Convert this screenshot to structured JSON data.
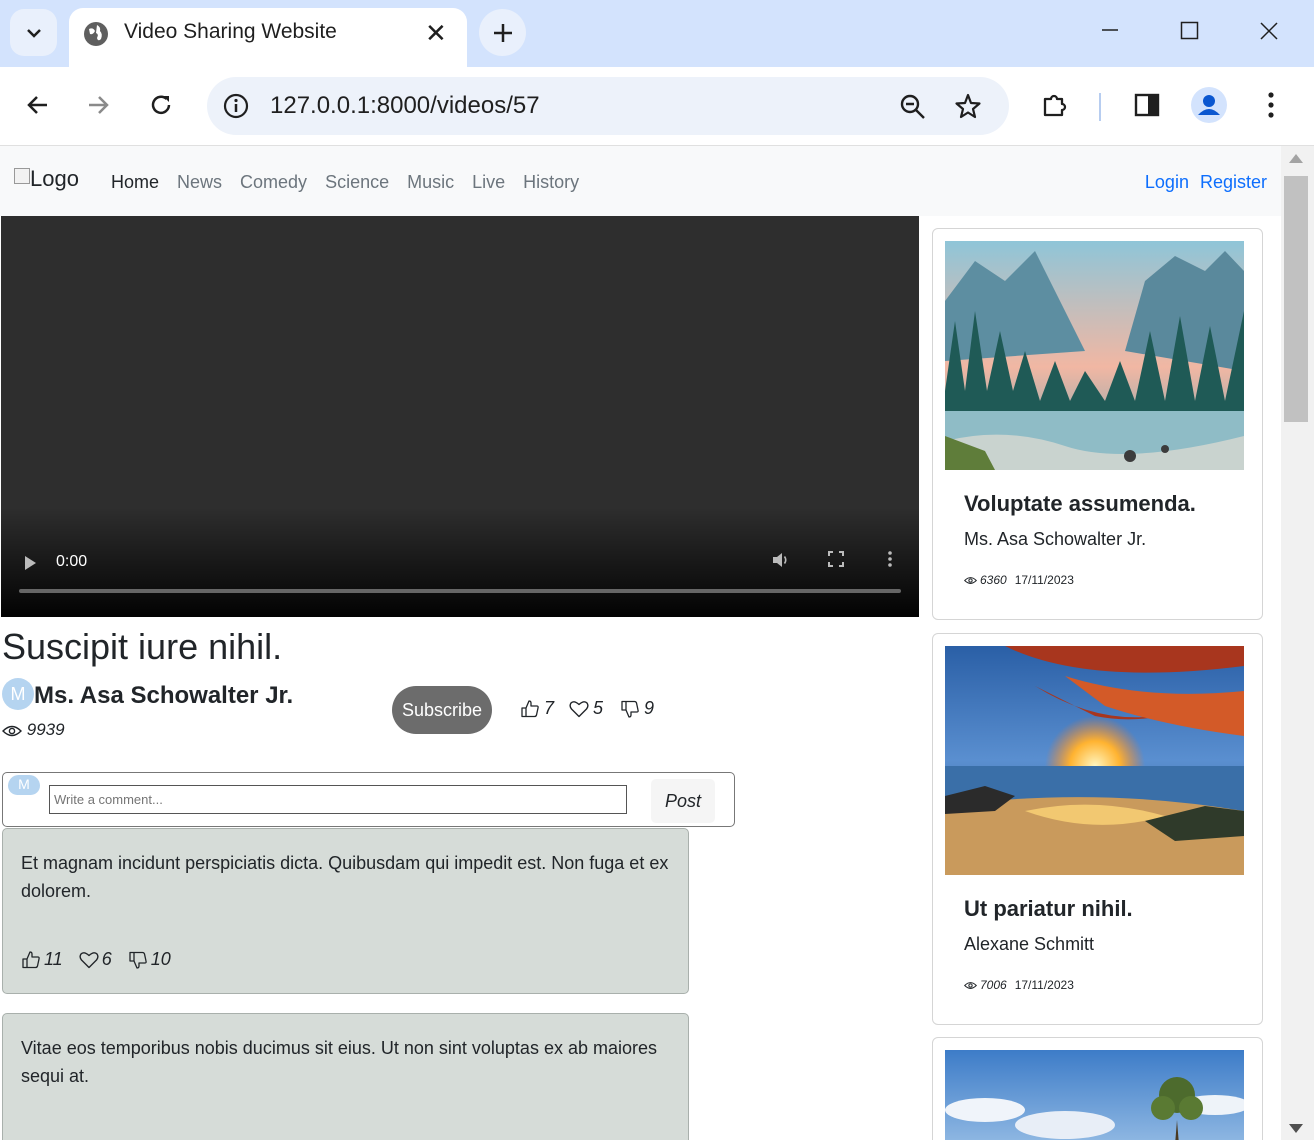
{
  "browser": {
    "tab_title": "Video Sharing Website",
    "url": "127.0.0.1:8000/videos/57"
  },
  "nav": {
    "logo_alt": "Logo",
    "links": [
      "Home",
      "News",
      "Comedy",
      "Science",
      "Music",
      "Live",
      "History"
    ],
    "login": "Login",
    "register": "Register"
  },
  "video": {
    "time": "0:00",
    "title": "Suscipit iure nihil.",
    "author_initial": "M",
    "author": "Ms. Asa Schowalter Jr.",
    "views": "9939",
    "subscribe_label": "Subscribe",
    "likes": "7",
    "hearts": "5",
    "dislikes": "9"
  },
  "comment_form": {
    "avatar_initial": "M",
    "placeholder": "Write a comment...",
    "post_label": "Post"
  },
  "comments": [
    {
      "text": "Et magnam incidunt perspiciatis dicta. Quibusdam qui impedit est. Non fuga et ex dolorem.",
      "likes": "11",
      "hearts": "6",
      "dislikes": "10"
    },
    {
      "text": "Vitae eos temporibus nobis ducimus sit eius. Ut non sint voluptas ex ab maiores sequi at.",
      "likes": "",
      "hearts": "",
      "dislikes": ""
    }
  ],
  "sidebar": [
    {
      "title": "Voluptate assumenda.",
      "author": "Ms. Asa Schowalter Jr.",
      "views": "6360",
      "date": "17/11/2023",
      "thumb": "mountain-lake"
    },
    {
      "title": "Ut pariatur nihil.",
      "author": "Alexane Schmitt",
      "views": "7006",
      "date": "17/11/2023",
      "thumb": "sunset-beach"
    },
    {
      "title": "",
      "author": "",
      "views": "",
      "date": "",
      "thumb": "sky-tree"
    }
  ],
  "colors": {
    "tabbar": "#d3e3fd",
    "link_blue": "#0d6efd",
    "comment_bg": "#d6dcd8",
    "subscribe_bg": "#6c6c6c"
  }
}
